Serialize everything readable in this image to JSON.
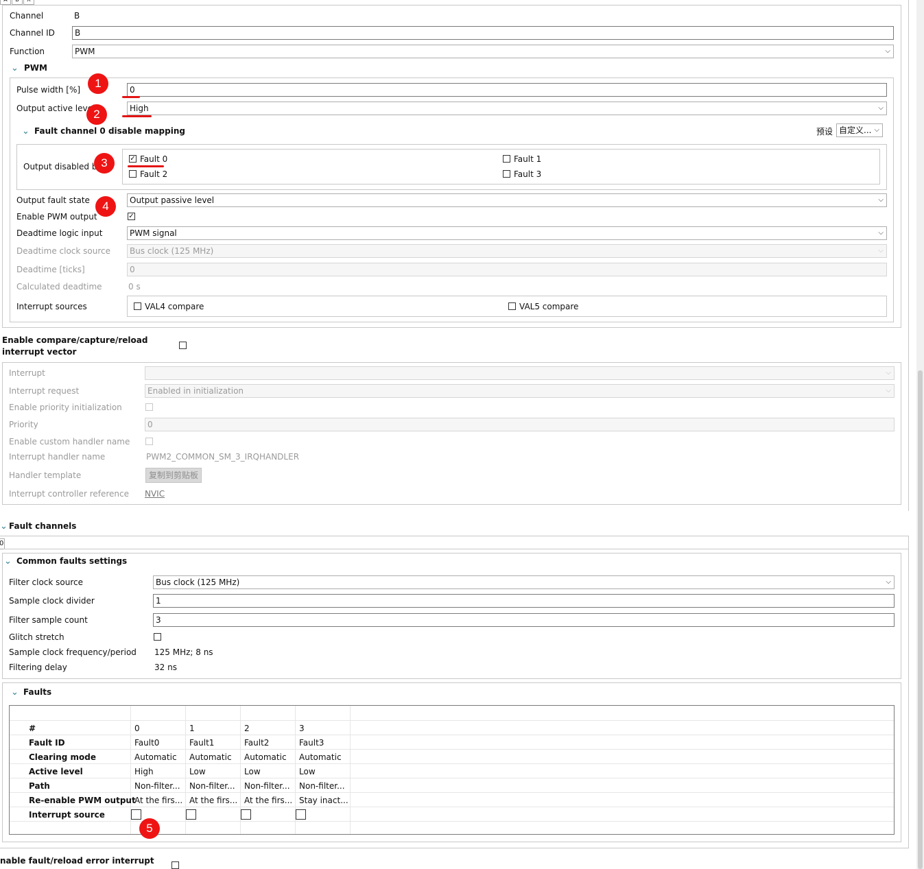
{
  "tabs": [
    "A",
    "B",
    "X"
  ],
  "channel": {
    "channel_label": "Channel",
    "channel_value": "B",
    "channel_id_label": "Channel ID",
    "channel_id_value": "B",
    "function_label": "Function",
    "function_value": "PWM"
  },
  "pwm": {
    "section_title": "PWM",
    "pulse_width_label": "Pulse width [%]",
    "pulse_width_value": "0",
    "output_active_level_label": "Output active level",
    "output_active_level_value": "High",
    "fault_mapping_title": "Fault channel 0 disable mapping",
    "preset_label": "预设",
    "preset_value": "自定义...",
    "output_disabled_label": "Output disabled by",
    "faults": [
      {
        "label": "Fault 0",
        "checked": true
      },
      {
        "label": "Fault 1",
        "checked": false
      },
      {
        "label": "Fault 2",
        "checked": false
      },
      {
        "label": "Fault 3",
        "checked": false
      }
    ],
    "output_fault_state_label": "Output fault state",
    "output_fault_state_value": "Output passive level",
    "enable_pwm_output_label": "Enable PWM output",
    "deadtime_logic_label": "Deadtime logic input",
    "deadtime_logic_value": "PWM signal",
    "deadtime_clock_label": "Deadtime clock source",
    "deadtime_clock_value": "Bus clock (125 MHz)",
    "deadtime_ticks_label": "Deadtime [ticks]",
    "deadtime_ticks_value": "0",
    "calc_deadtime_label": "Calculated deadtime",
    "calc_deadtime_value": "0 s",
    "interrupt_sources_label": "Interrupt sources",
    "val4_label": "VAL4 compare",
    "val5_label": "VAL5 compare"
  },
  "ccr": {
    "enable_label_1": "Enable compare/capture/reload",
    "enable_label_2": "interrupt vector",
    "interrupt_label": "Interrupt",
    "interrupt_value": "",
    "interrupt_request_label": "Interrupt request",
    "interrupt_request_value": "Enabled in initialization",
    "enable_priority_label": "Enable priority initialization",
    "priority_label": "Priority",
    "priority_value": "0",
    "custom_handler_label": "Enable custom handler name",
    "handler_name_label": "Interrupt handler name",
    "handler_name_value": "PWM2_COMMON_SM_3_IRQHANDLER",
    "handler_template_label": "Handler template",
    "copy_button": "复制到剪贴板",
    "controller_ref_label": "Interrupt controller reference",
    "controller_ref_value": "NVIC"
  },
  "fault_channels": {
    "title": "Fault channels",
    "tab": "0",
    "common_title": "Common faults settings",
    "filter_clock_label": "Filter clock source",
    "filter_clock_value": "Bus clock (125 MHz)",
    "sample_divider_label": "Sample clock divider",
    "sample_divider_value": "1",
    "filter_count_label": "Filter sample count",
    "filter_count_value": "3",
    "glitch_label": "Glitch stretch",
    "sample_freq_label": "Sample clock frequency/period",
    "sample_freq_value": "125 MHz; 8 ns",
    "filter_delay_label": "Filtering delay",
    "filter_delay_value": "32 ns"
  },
  "faults_table": {
    "title": "Faults",
    "row_headers": [
      "#",
      "Fault ID",
      "Clearing mode",
      "Active level",
      "Path",
      "Re-enable PWM output",
      "Interrupt source"
    ],
    "columns": [
      [
        "0",
        "Fault0",
        "Automatic",
        "High",
        "Non-filter...",
        "At the firs..."
      ],
      [
        "1",
        "Fault1",
        "Automatic",
        "Low",
        "Non-filter...",
        "At the firs..."
      ],
      [
        "2",
        "Fault2",
        "Automatic",
        "Low",
        "Non-filter...",
        "At the firs..."
      ],
      [
        "3",
        "Fault3",
        "Automatic",
        "Low",
        "Non-filter...",
        "Stay inact..."
      ]
    ]
  },
  "footer": {
    "enable_fault_label": "nable fault/reload error interrupt"
  },
  "annotations": [
    "1",
    "2",
    "3",
    "4",
    "5"
  ],
  "colors": {
    "badge": "#ef1414",
    "chevron": "#2f7f8f",
    "border": "#c8c8c8"
  }
}
